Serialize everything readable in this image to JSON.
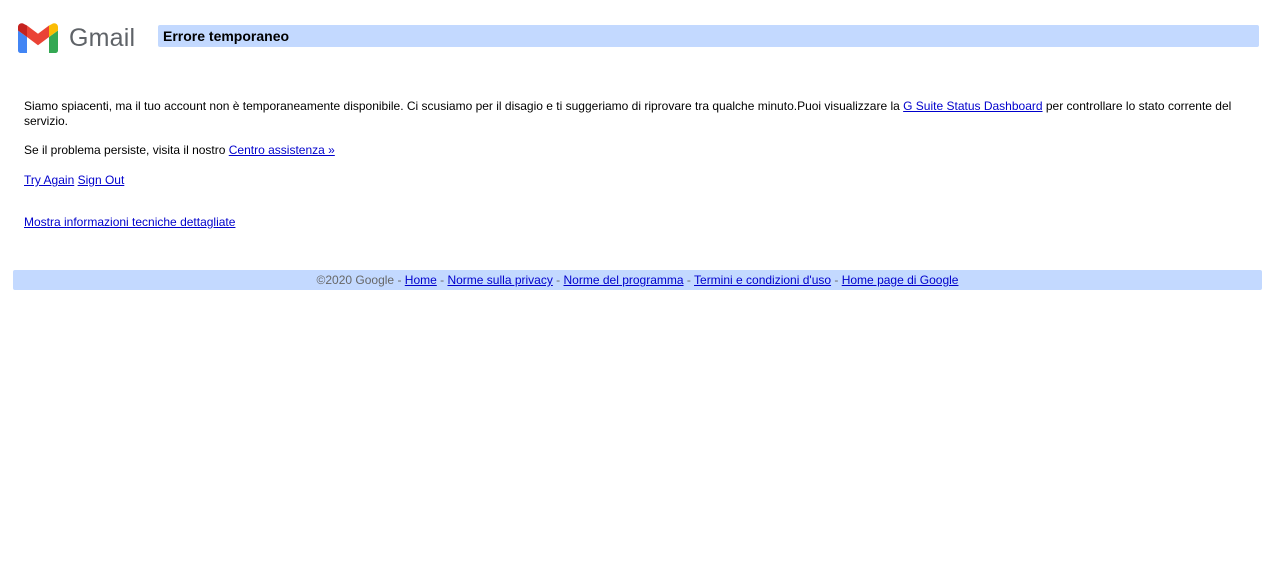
{
  "header": {
    "logo_text": "Gmail",
    "title": "Errore temporaneo"
  },
  "message": {
    "before_link": "Siamo spiacenti, ma il tuo account non è temporaneamente disponibile. Ci scusiamo per il disagio e ti suggeriamo di riprovare tra qualche minuto.Puoi visualizzare la ",
    "status_link": "G Suite Status Dashboard",
    "after_link": " per controllare lo stato corrente del servizio."
  },
  "persist": {
    "text": "Se il problema persiste, visita il nostro ",
    "help_link": "Centro assistenza »"
  },
  "actions": {
    "try_again": "Try Again",
    "sign_out": "Sign Out"
  },
  "details_link": "Mostra informazioni tecniche dettagliate",
  "footer": {
    "copyright": "©2020 Google",
    "separator": " - ",
    "links": [
      "Home",
      "Norme sulla privacy",
      "Norme del programma",
      "Termini e condizioni d'uso",
      "Home page di Google"
    ]
  },
  "colors": {
    "bar_background": "#c3d9ff",
    "link": "#0000cc",
    "logo_text": "#5f6368"
  },
  "icons": {
    "logo": "gmail-m-logo-icon"
  }
}
